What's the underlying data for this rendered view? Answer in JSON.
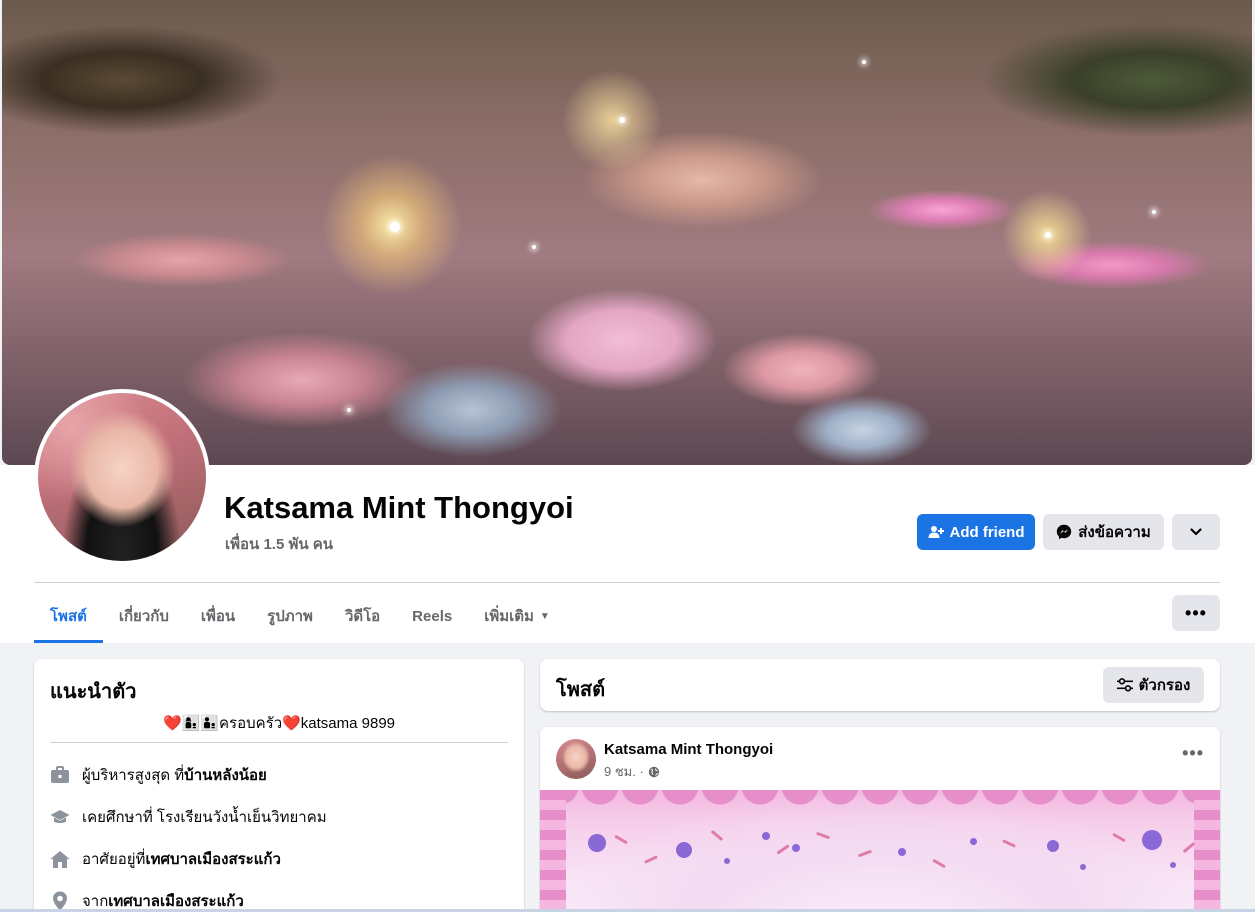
{
  "profile": {
    "name": "Katsama Mint Thongyoi",
    "friends": "เพื่อน 1.5 พัน คน"
  },
  "actions": {
    "add_friend": "Add friend",
    "message": "ส่งข้อความ",
    "more_icon": "chevron-down-icon"
  },
  "tabs": [
    {
      "label": "โพสต์",
      "active": true
    },
    {
      "label": "เกี่ยวกับ",
      "active": false
    },
    {
      "label": "เพื่อน",
      "active": false
    },
    {
      "label": "รูปภาพ",
      "active": false
    },
    {
      "label": "วิดีโอ",
      "active": false
    },
    {
      "label": "Reels",
      "active": false
    },
    {
      "label": "เพิ่มเติม",
      "active": false
    }
  ],
  "tabs_more_icon": "ellipsis-icon",
  "intro": {
    "title": "แนะนำตัว",
    "bio": "❤️👩‍👦👨‍👦ครอบครัว❤️katsama 9899",
    "items": [
      {
        "icon": "briefcase-icon",
        "prefix": "ผู้บริหารสูงสุด ที่ ",
        "bold": "บ้านหลังน้อย"
      },
      {
        "icon": "graduation-cap-icon",
        "prefix": "เคยศึกษาที่ โรงเรียนวังน้ำเย็นวิทยาคม",
        "bold": ""
      },
      {
        "icon": "home-icon",
        "prefix": "อาศัยอยู่ที่ ",
        "bold": "เทศบาลเมืองสระแก้ว"
      },
      {
        "icon": "location-pin-icon",
        "prefix": "จาก ",
        "bold": "เทศบาลเมืองสระแก้ว"
      }
    ]
  },
  "posts": {
    "title": "โพสต์",
    "filter_label": "ตัวกรอง"
  },
  "post": {
    "author": "Katsama Mint Thongyoi",
    "time": "9 ชม. ·",
    "privacy_icon": "globe-icon"
  },
  "colors": {
    "accent": "#1b74e4",
    "secondary_button": "#e4e6eb",
    "background": "#f0f2f5"
  }
}
